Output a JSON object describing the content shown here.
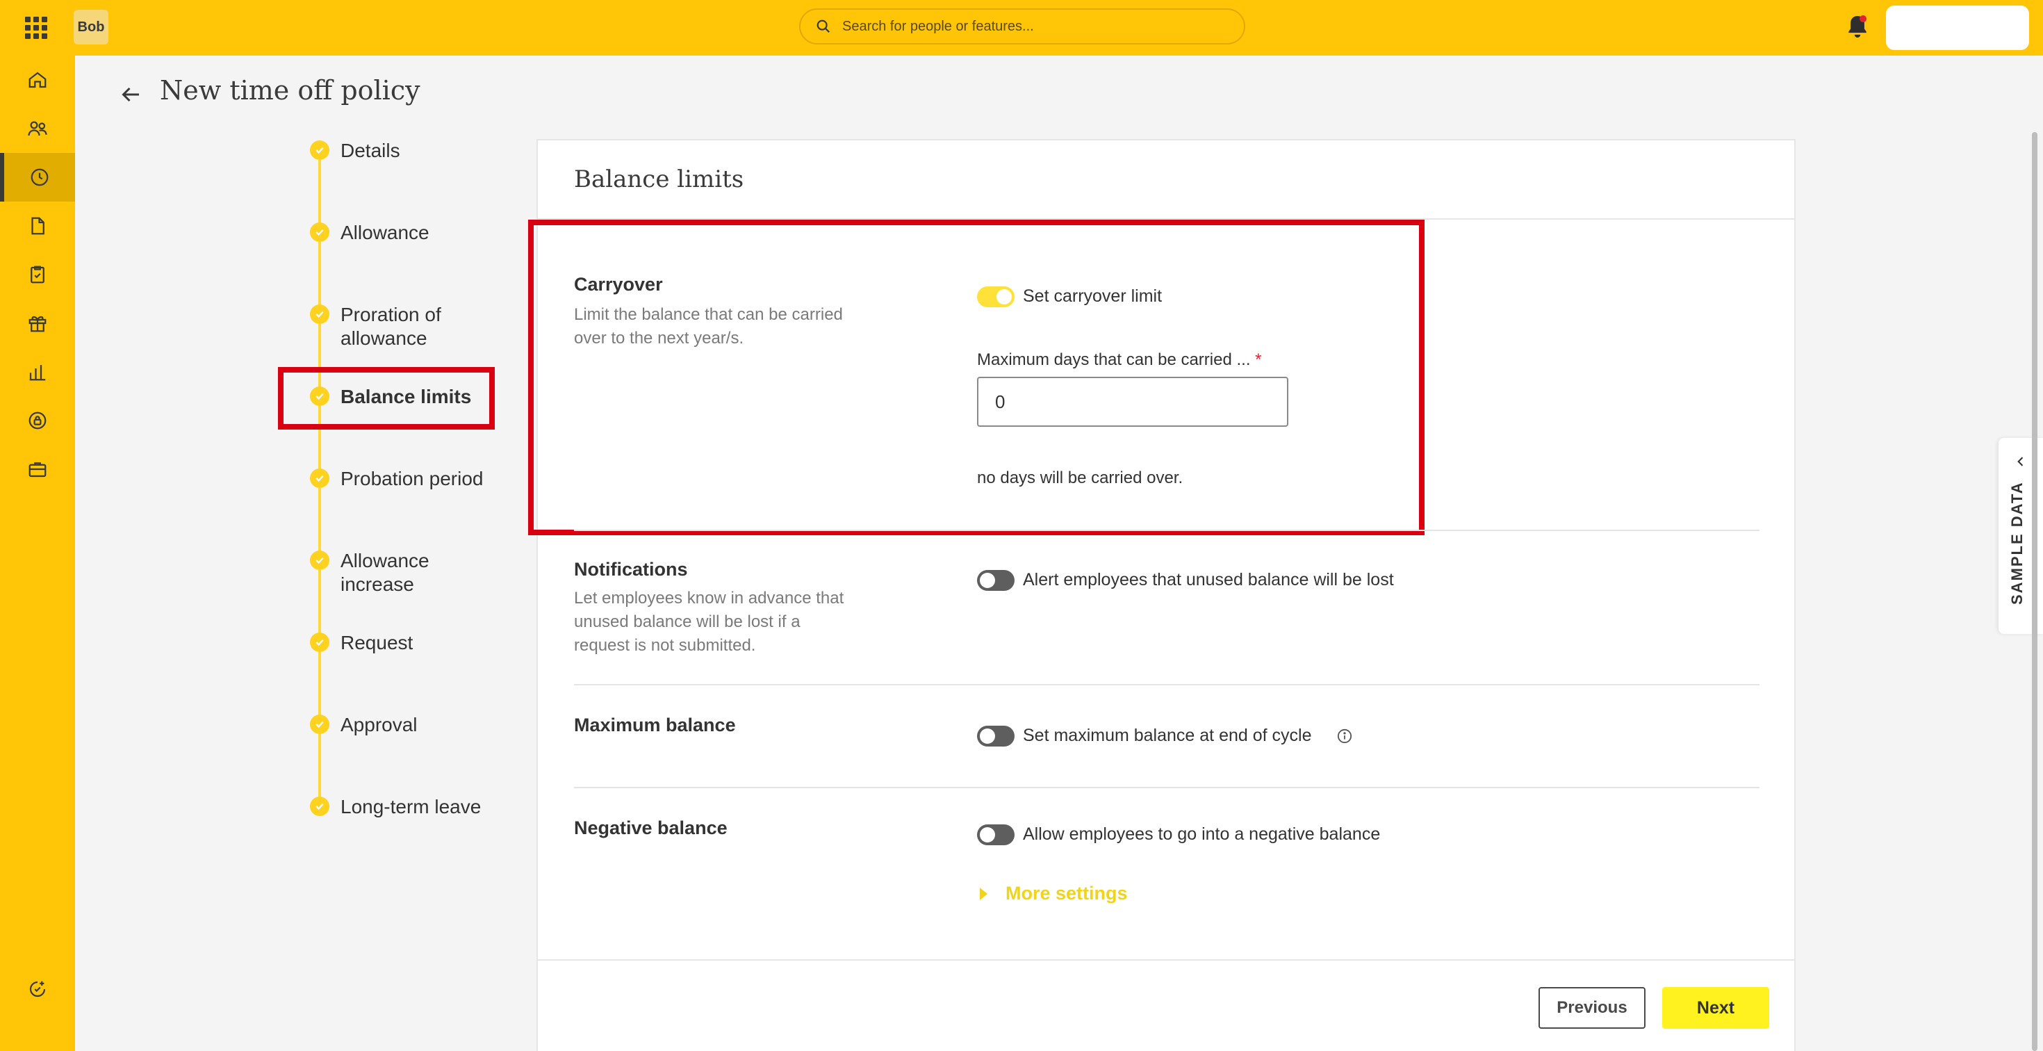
{
  "topbar": {
    "logo": "Bob",
    "search_placeholder": "Search for people or features..."
  },
  "sidebar": {
    "items": [
      "home-icon",
      "people-icon",
      "time-off-icon",
      "documents-icon",
      "tasks-icon",
      "gift-icon",
      "analytics-icon",
      "security-icon",
      "briefcase-icon",
      "whats-new-icon"
    ],
    "active": "time-off-icon"
  },
  "page": {
    "title": "New time off policy"
  },
  "stepper": {
    "steps": [
      "Details",
      "Allowance",
      "Proration of allowance",
      "Balance limits",
      "Probation period",
      "Allowance increase",
      "Request",
      "Approval",
      "Long-term leave"
    ],
    "current": "Balance limits"
  },
  "card": {
    "title": "Balance limits",
    "carryover": {
      "title": "Carryover",
      "description": "Limit the balance that can be carried over to the next year/s.",
      "toggle_label": "Set carryover limit",
      "toggle_on": true,
      "field_label": "Maximum days that can be carried ...",
      "field_required_mark": "*",
      "field_value": "0",
      "helper": "no days will be carried over."
    },
    "notifications": {
      "title": "Notifications",
      "description": "Let employees know in advance that unused balance will be lost if a request is not submitted.",
      "toggle_label": "Alert employees that unused balance will be lost",
      "toggle_on": false
    },
    "maximum_balance": {
      "title": "Maximum balance",
      "toggle_label": "Set maximum balance at end of cycle",
      "toggle_on": false
    },
    "negative_balance": {
      "title": "Negative balance",
      "toggle_label": "Allow employees to go into a negative balance",
      "toggle_on": false
    },
    "more_settings": "More settings"
  },
  "footer": {
    "previous_label": "Previous",
    "next_label": "Next"
  },
  "side_tab": {
    "label": "SAMPLE DATA"
  },
  "colors": {
    "brand_yellow": "#ffc506",
    "accent_yellow": "#fff21f",
    "highlight_red": "#d90012"
  }
}
